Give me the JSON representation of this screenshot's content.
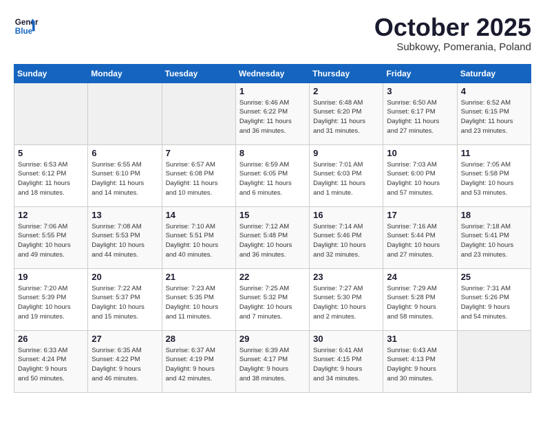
{
  "header": {
    "logo_line1": "General",
    "logo_line2": "Blue",
    "month": "October 2025",
    "location": "Subkowy, Pomerania, Poland"
  },
  "days_of_week": [
    "Sunday",
    "Monday",
    "Tuesday",
    "Wednesday",
    "Thursday",
    "Friday",
    "Saturday"
  ],
  "weeks": [
    [
      {
        "day": "",
        "info": ""
      },
      {
        "day": "",
        "info": ""
      },
      {
        "day": "",
        "info": ""
      },
      {
        "day": "1",
        "info": "Sunrise: 6:46 AM\nSunset: 6:22 PM\nDaylight: 11 hours\nand 36 minutes."
      },
      {
        "day": "2",
        "info": "Sunrise: 6:48 AM\nSunset: 6:20 PM\nDaylight: 11 hours\nand 31 minutes."
      },
      {
        "day": "3",
        "info": "Sunrise: 6:50 AM\nSunset: 6:17 PM\nDaylight: 11 hours\nand 27 minutes."
      },
      {
        "day": "4",
        "info": "Sunrise: 6:52 AM\nSunset: 6:15 PM\nDaylight: 11 hours\nand 23 minutes."
      }
    ],
    [
      {
        "day": "5",
        "info": "Sunrise: 6:53 AM\nSunset: 6:12 PM\nDaylight: 11 hours\nand 18 minutes."
      },
      {
        "day": "6",
        "info": "Sunrise: 6:55 AM\nSunset: 6:10 PM\nDaylight: 11 hours\nand 14 minutes."
      },
      {
        "day": "7",
        "info": "Sunrise: 6:57 AM\nSunset: 6:08 PM\nDaylight: 11 hours\nand 10 minutes."
      },
      {
        "day": "8",
        "info": "Sunrise: 6:59 AM\nSunset: 6:05 PM\nDaylight: 11 hours\nand 6 minutes."
      },
      {
        "day": "9",
        "info": "Sunrise: 7:01 AM\nSunset: 6:03 PM\nDaylight: 11 hours\nand 1 minute."
      },
      {
        "day": "10",
        "info": "Sunrise: 7:03 AM\nSunset: 6:00 PM\nDaylight: 10 hours\nand 57 minutes."
      },
      {
        "day": "11",
        "info": "Sunrise: 7:05 AM\nSunset: 5:58 PM\nDaylight: 10 hours\nand 53 minutes."
      }
    ],
    [
      {
        "day": "12",
        "info": "Sunrise: 7:06 AM\nSunset: 5:55 PM\nDaylight: 10 hours\nand 49 minutes."
      },
      {
        "day": "13",
        "info": "Sunrise: 7:08 AM\nSunset: 5:53 PM\nDaylight: 10 hours\nand 44 minutes."
      },
      {
        "day": "14",
        "info": "Sunrise: 7:10 AM\nSunset: 5:51 PM\nDaylight: 10 hours\nand 40 minutes."
      },
      {
        "day": "15",
        "info": "Sunrise: 7:12 AM\nSunset: 5:48 PM\nDaylight: 10 hours\nand 36 minutes."
      },
      {
        "day": "16",
        "info": "Sunrise: 7:14 AM\nSunset: 5:46 PM\nDaylight: 10 hours\nand 32 minutes."
      },
      {
        "day": "17",
        "info": "Sunrise: 7:16 AM\nSunset: 5:44 PM\nDaylight: 10 hours\nand 27 minutes."
      },
      {
        "day": "18",
        "info": "Sunrise: 7:18 AM\nSunset: 5:41 PM\nDaylight: 10 hours\nand 23 minutes."
      }
    ],
    [
      {
        "day": "19",
        "info": "Sunrise: 7:20 AM\nSunset: 5:39 PM\nDaylight: 10 hours\nand 19 minutes."
      },
      {
        "day": "20",
        "info": "Sunrise: 7:22 AM\nSunset: 5:37 PM\nDaylight: 10 hours\nand 15 minutes."
      },
      {
        "day": "21",
        "info": "Sunrise: 7:23 AM\nSunset: 5:35 PM\nDaylight: 10 hours\nand 11 minutes."
      },
      {
        "day": "22",
        "info": "Sunrise: 7:25 AM\nSunset: 5:32 PM\nDaylight: 10 hours\nand 7 minutes."
      },
      {
        "day": "23",
        "info": "Sunrise: 7:27 AM\nSunset: 5:30 PM\nDaylight: 10 hours\nand 2 minutes."
      },
      {
        "day": "24",
        "info": "Sunrise: 7:29 AM\nSunset: 5:28 PM\nDaylight: 9 hours\nand 58 minutes."
      },
      {
        "day": "25",
        "info": "Sunrise: 7:31 AM\nSunset: 5:26 PM\nDaylight: 9 hours\nand 54 minutes."
      }
    ],
    [
      {
        "day": "26",
        "info": "Sunrise: 6:33 AM\nSunset: 4:24 PM\nDaylight: 9 hours\nand 50 minutes."
      },
      {
        "day": "27",
        "info": "Sunrise: 6:35 AM\nSunset: 4:22 PM\nDaylight: 9 hours\nand 46 minutes."
      },
      {
        "day": "28",
        "info": "Sunrise: 6:37 AM\nSunset: 4:19 PM\nDaylight: 9 hours\nand 42 minutes."
      },
      {
        "day": "29",
        "info": "Sunrise: 6:39 AM\nSunset: 4:17 PM\nDaylight: 9 hours\nand 38 minutes."
      },
      {
        "day": "30",
        "info": "Sunrise: 6:41 AM\nSunset: 4:15 PM\nDaylight: 9 hours\nand 34 minutes."
      },
      {
        "day": "31",
        "info": "Sunrise: 6:43 AM\nSunset: 4:13 PM\nDaylight: 9 hours\nand 30 minutes."
      },
      {
        "day": "",
        "info": ""
      }
    ]
  ]
}
